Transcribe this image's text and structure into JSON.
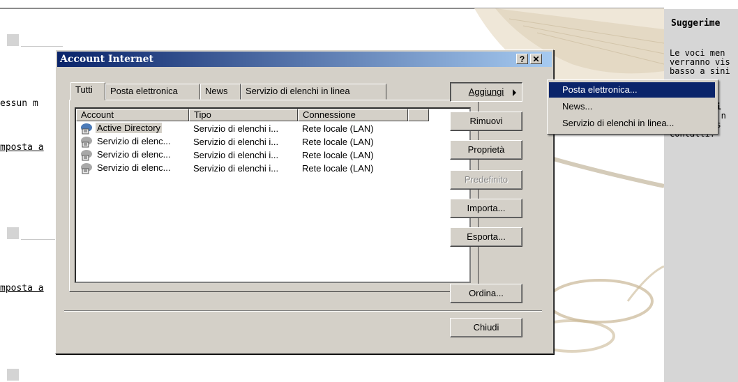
{
  "background": {
    "snippet1": "essun m",
    "link1": "mposta a",
    "link2": "mposta a",
    "right_panel": {
      "title": "Suggerime",
      "lines": [
        "Le voci men",
        "verranno vis",
        "basso a sini",
        "ppi",
        "to n",
        "ess",
        "contatti."
      ]
    }
  },
  "dialog": {
    "title": "Account Internet",
    "help_btn": "?",
    "close_btn": "✕",
    "tabs": [
      "Tutti",
      "Posta elettronica",
      "News",
      "Servizio di elenchi in linea"
    ],
    "columns": [
      "Account",
      "Tipo",
      "Connessione"
    ],
    "rows": [
      {
        "account": "Active Directory",
        "type": "Servizio di elenchi i...",
        "connection": "Rete locale (LAN)"
      },
      {
        "account": "Servizio di elenc...",
        "type": "Servizio di elenchi i...",
        "connection": "Rete locale (LAN)"
      },
      {
        "account": "Servizio di elenc...",
        "type": "Servizio di elenchi i...",
        "connection": "Rete locale (LAN)"
      },
      {
        "account": "Servizio di elenc...",
        "type": "Servizio di elenchi i...",
        "connection": "Rete locale (LAN)"
      }
    ],
    "buttons": {
      "add": "Aggiungi",
      "remove": "Rimuovi",
      "properties": "Proprietà",
      "default": "Predefinito",
      "import": "Importa...",
      "export": "Esporta...",
      "order": "Ordina...",
      "close": "Chiudi"
    }
  },
  "add_menu": [
    "Posta elettronica...",
    "News...",
    "Servizio di elenchi in linea..."
  ],
  "colors": {
    "title_gradient_start": "#0a246a",
    "title_gradient_end": "#a6caf0",
    "face": "#d4d0c8",
    "highlight": "#0a246a"
  },
  "icons": [
    "directory-service-icon",
    "submenu-arrow-icon"
  ]
}
